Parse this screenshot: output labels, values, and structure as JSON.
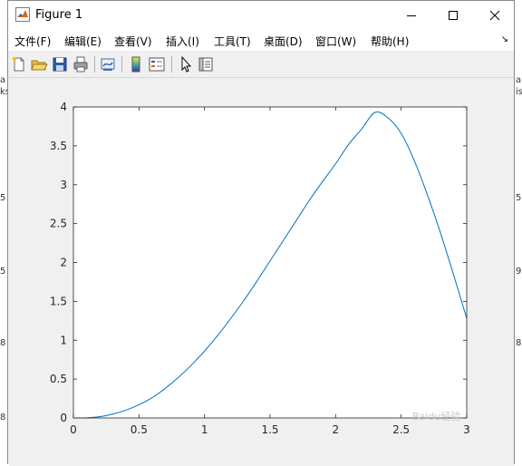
{
  "window": {
    "title": "Figure 1",
    "controls": {
      "minimize": "minimize",
      "maximize": "maximize",
      "close": "close"
    }
  },
  "menubar": {
    "items": [
      {
        "label": "文件(F)"
      },
      {
        "label": "编辑(E)"
      },
      {
        "label": "查看(V)"
      },
      {
        "label": "插入(I)"
      },
      {
        "label": "工具(T)"
      },
      {
        "label": "桌面(D)"
      },
      {
        "label": "窗口(W)"
      },
      {
        "label": "帮助(H)"
      }
    ],
    "overflow_glyph": "↘"
  },
  "toolbar": {
    "buttons": [
      "new-figure-icon",
      "open-file-icon",
      "save-icon",
      "print-icon",
      "link-icon",
      "colorbar-icon",
      "legend-icon",
      "pointer-icon",
      "property-inspector-icon"
    ]
  },
  "background_marks": {
    "left": [
      "a",
      "ks",
      "5",
      "5",
      "8",
      "8"
    ],
    "right": [
      "a",
      "is",
      "5",
      "9",
      "8"
    ]
  },
  "watermark": "Baidu经验",
  "chart_data": {
    "type": "line",
    "title": "",
    "xlabel": "",
    "ylabel": "",
    "xlim": [
      0,
      3
    ],
    "ylim": [
      0,
      4
    ],
    "xticks": [
      "0",
      "0.5",
      "1",
      "1.5",
      "2",
      "2.5",
      "3"
    ],
    "yticks": [
      "0",
      "0.5",
      "1",
      "1.5",
      "2",
      "2.5",
      "3",
      "3.5",
      "4"
    ],
    "grid": false,
    "series": [
      {
        "color": "#0072bd",
        "x": [
          0,
          0.1,
          0.2,
          0.3,
          0.4,
          0.5,
          0.6,
          0.7,
          0.8,
          0.9,
          1.0,
          1.1,
          1.2,
          1.3,
          1.4,
          1.5,
          1.6,
          1.7,
          1.8,
          1.9,
          2.0,
          2.1,
          2.2,
          2.3,
          2.4,
          2.5,
          2.6,
          2.7,
          2.8,
          2.9,
          3.0
        ],
        "y": [
          0,
          0.002,
          0.016,
          0.05,
          0.1,
          0.17,
          0.26,
          0.38,
          0.52,
          0.68,
          0.86,
          1.06,
          1.28,
          1.51,
          1.76,
          2.02,
          2.28,
          2.54,
          2.8,
          3.04,
          3.27,
          3.52,
          3.72,
          3.93,
          3.86,
          3.66,
          3.31,
          2.87,
          2.38,
          1.84,
          1.28
        ]
      }
    ]
  }
}
